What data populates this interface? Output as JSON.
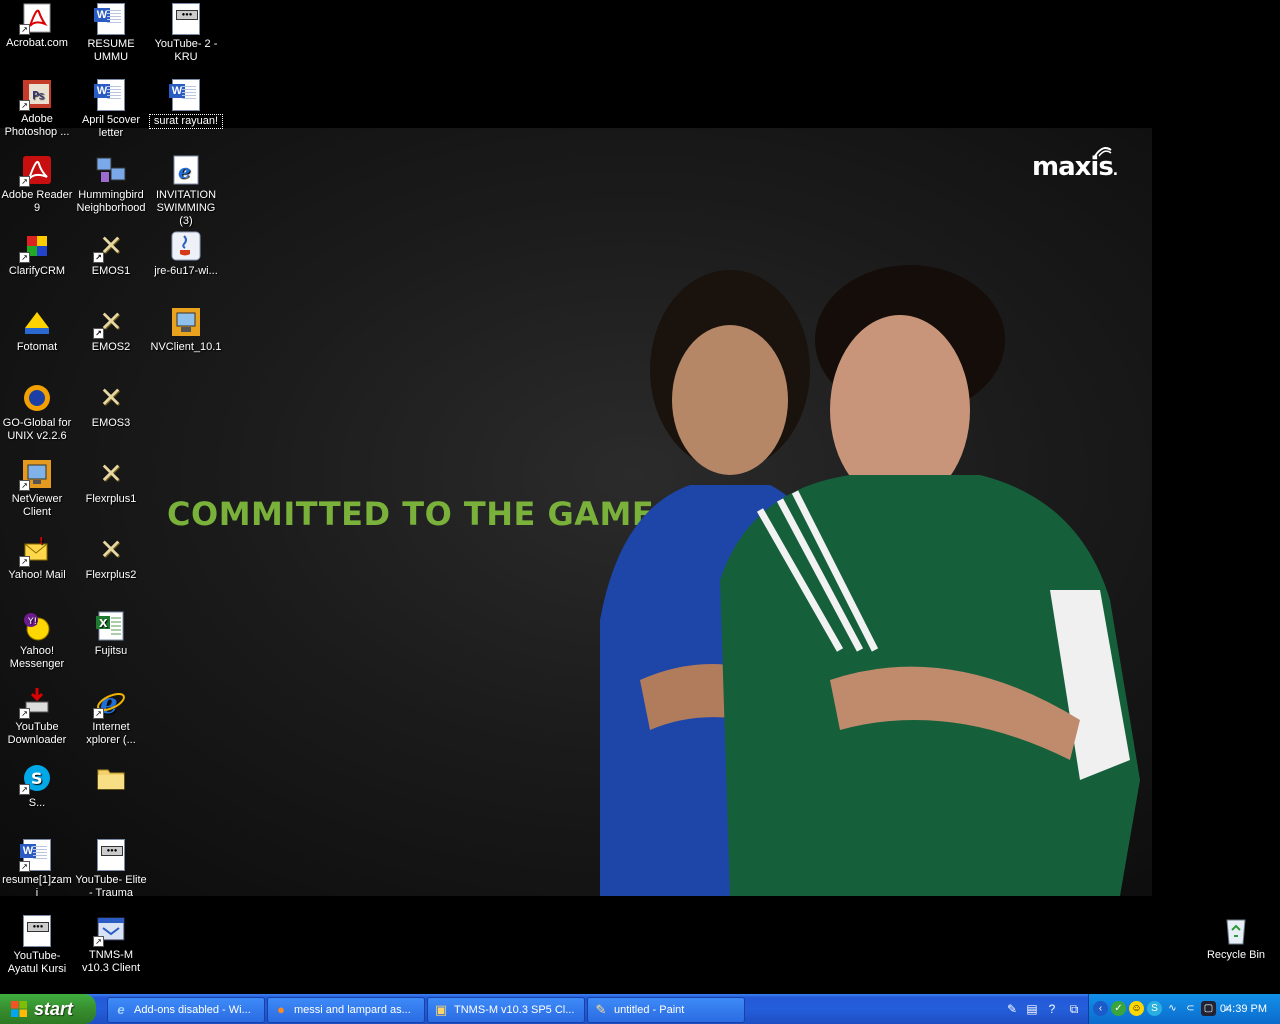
{
  "wallpaper": {
    "slogan": "COMMITTED TO THE GAME",
    "brand": "maxis",
    "brand_dot": "."
  },
  "desktop_icons": [
    {
      "label": "Acrobat.com",
      "icon": "acrobat-icon"
    },
    {
      "label": "RESUME UMMU",
      "icon": "word-doc-icon"
    },
    {
      "label": "YouTube- 2 - KRU",
      "icon": "web-page-icon"
    },
    {
      "label": "Adobe Photoshop ...",
      "icon": "photoshop-icon"
    },
    {
      "label": "April 5cover letter",
      "icon": "word-doc-icon"
    },
    {
      "label": "surat rayuan!",
      "icon": "word-doc-icon"
    },
    {
      "label": "Adobe Reader 9",
      "icon": "adobe-reader-icon"
    },
    {
      "label": "Hummingbird Neighborhood",
      "icon": "network-neighborhood-icon"
    },
    {
      "label": "INVITATION SWIMMING (3)",
      "icon": "internet-explorer-doc-icon"
    },
    {
      "label": "ClarifyCRM",
      "icon": "clarifycrm-icon"
    },
    {
      "label": "EMOS1",
      "icon": "exceed-x-icon"
    },
    {
      "label": "jre-6u17-wi...",
      "icon": "java-icon"
    },
    {
      "label": "Fotomat",
      "icon": "fotomat-icon"
    },
    {
      "label": "EMOS2",
      "icon": "exceed-x-icon"
    },
    {
      "label": "NVClient_10.1",
      "icon": "nvclient-icon"
    },
    {
      "label": "GO-Global for UNIX v2.2.6",
      "icon": "go-global-icon"
    },
    {
      "label": "EMOS3",
      "icon": "exceed-x-icon"
    },
    {
      "label": "NetViewer Client",
      "icon": "netviewer-icon"
    },
    {
      "label": "Flexrplus1",
      "icon": "exceed-x-icon"
    },
    {
      "label": "Yahoo! Mail",
      "icon": "yahoo-mail-icon"
    },
    {
      "label": "Flexrplus2",
      "icon": "exceed-x-icon"
    },
    {
      "label": "Yahoo! Messenger",
      "icon": "yahoo-messenger-icon"
    },
    {
      "label": "Fujitsu",
      "icon": "excel-doc-icon"
    },
    {
      "label": "YouTube Downloader",
      "icon": "youtube-downloader-icon"
    },
    {
      "label": "Internet xplorer (...",
      "icon": "internet-explorer-icon"
    },
    {
      "label": "S...",
      "icon": "skype-icon"
    },
    {
      "label": "",
      "icon": "folder-icon"
    },
    {
      "label": "resume[1]zami",
      "icon": "word-doc-icon"
    },
    {
      "label": "YouTube- Elite - Trauma",
      "icon": "web-page-icon"
    },
    {
      "label": "YouTube- Ayatul Kursi",
      "icon": "web-page-icon"
    },
    {
      "label": "TNMS-M v10.3 Client",
      "icon": "tnms-icon"
    },
    {
      "label": "Recycle Bin",
      "icon": "recycle-bin-icon"
    }
  ],
  "taskbar": {
    "start_label": "start",
    "tasks": [
      {
        "label": "Add-ons disabled - Wi...",
        "icon": "internet-explorer-icon"
      },
      {
        "label": "messi and lampard as...",
        "icon": "firefox-icon"
      },
      {
        "label": "TNMS-M v10.3 SP5 Cl...",
        "icon": "tnms-icon"
      },
      {
        "label": "untitled - Paint",
        "icon": "paint-icon"
      }
    ],
    "clock": "04:39 PM"
  }
}
